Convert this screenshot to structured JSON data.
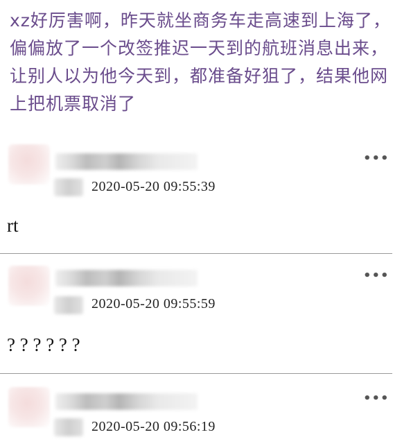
{
  "post": {
    "text": "xz好厉害啊，昨天就坐商务车走高速到上海了，偏偏放了一个改签推迟一天到的航班消息出来，让别人以为他今天到，都准备好狙了，结果他网上把机票取消了"
  },
  "comments": [
    {
      "timestamp": "2020-05-20 09:55:39",
      "text": "rt",
      "more_label": "•••",
      "icon": "more-dots-icon"
    },
    {
      "timestamp": "2020-05-20 09:55:59",
      "text": "? ? ? ? ? ?",
      "more_label": "•••",
      "icon": "more-dots-icon"
    },
    {
      "timestamp": "2020-05-20 09:56:19",
      "text": "",
      "more_label": "•••",
      "icon": "more-dots-icon"
    }
  ]
}
